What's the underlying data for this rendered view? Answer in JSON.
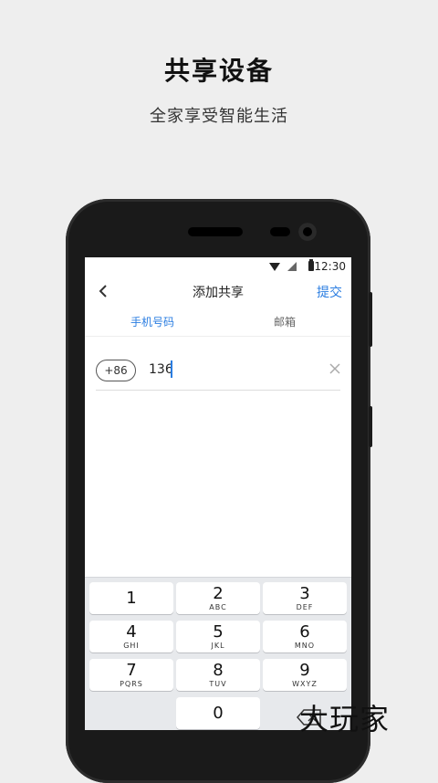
{
  "promo": {
    "title": "共享设备",
    "subtitle": "全家享受智能生活"
  },
  "status_bar": {
    "time": "12:30",
    "icons": [
      "wifi-icon",
      "signal-icon",
      "battery-icon"
    ]
  },
  "app_bar": {
    "back_icon": "chevron-left-icon",
    "title": "添加共享",
    "submit_label": "提交"
  },
  "tabs": [
    {
      "label": "手机号码",
      "active": true
    },
    {
      "label": "邮箱",
      "active": false
    }
  ],
  "phone_input": {
    "country_code": "+86",
    "value": "136",
    "clear_icon": "close-icon"
  },
  "keypad": {
    "keys": [
      {
        "num": "1",
        "letters": ""
      },
      {
        "num": "2",
        "letters": "ABC"
      },
      {
        "num": "3",
        "letters": "DEF"
      },
      {
        "num": "4",
        "letters": "GHI"
      },
      {
        "num": "5",
        "letters": "JKL"
      },
      {
        "num": "6",
        "letters": "MNO"
      },
      {
        "num": "7",
        "letters": "PQRS"
      },
      {
        "num": "8",
        "letters": "TUV"
      },
      {
        "num": "9",
        "letters": "WXYZ"
      },
      {
        "num": "0",
        "letters": ""
      }
    ],
    "backspace_icon": "backspace-icon"
  },
  "watermark": "大玩家",
  "colors": {
    "accent": "#2a7de1",
    "background": "#eeeeee",
    "phone_body": "#1a1a1a"
  }
}
